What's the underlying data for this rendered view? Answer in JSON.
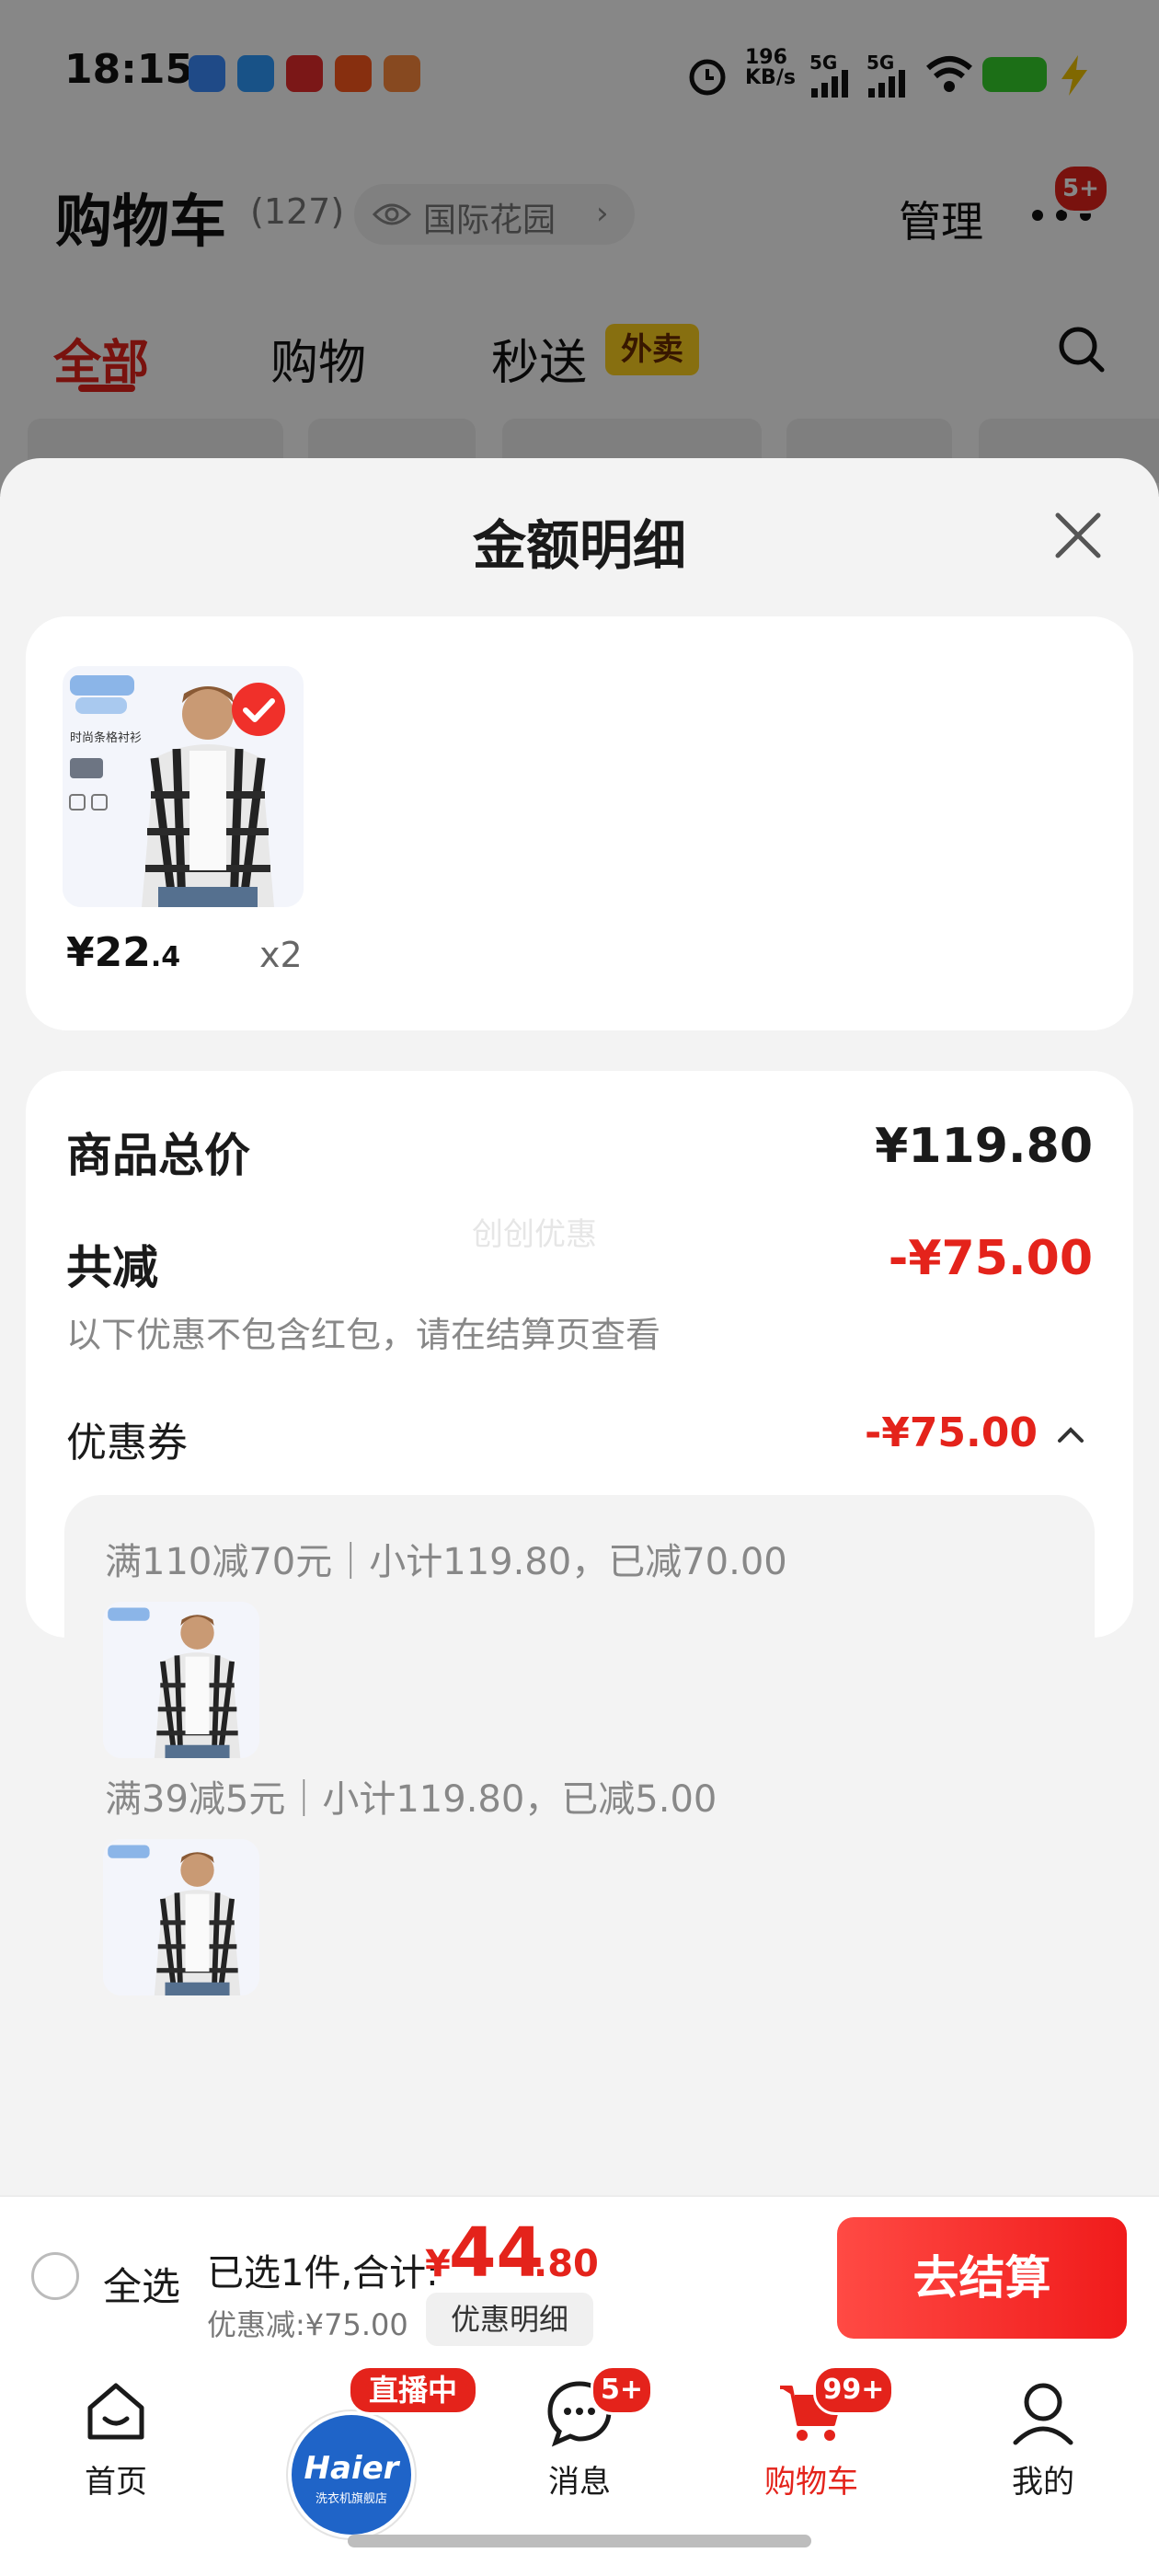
{
  "status_bar": {
    "time": "18:15",
    "net_speed": "196",
    "net_unit": "KB/s",
    "signal1": "5G",
    "signal2": "5G"
  },
  "cart_header": {
    "title": "购物车",
    "count": "(127)",
    "location": "国际花园",
    "manage": "管理",
    "more_badge": "5+"
  },
  "cart_tabs": [
    {
      "label": "全部",
      "active": true
    },
    {
      "label": "购物",
      "active": false
    },
    {
      "label": "秒送",
      "active": false
    }
  ],
  "waimai_tag": "外卖",
  "sheet": {
    "title": "金额明细",
    "product": {
      "price_int": "¥22",
      "price_dec": ".4",
      "qty": "x2",
      "img_text": "时尚条格衬衫"
    },
    "total_label": "商品总价",
    "total_value": "¥119.80",
    "reduce_label": "共减",
    "reduce_value": "-¥75.00",
    "reduce_note": "以下优惠不包含红包，请在结算页查看",
    "watermark": "创创优惠",
    "coupon_label": "优惠券",
    "coupon_value": "-¥75.00",
    "coupon_rules": [
      {
        "text": "满110减70元｜小计119.80，已减70.00"
      },
      {
        "text": "满39减5元｜小计119.80，已减5.00"
      }
    ]
  },
  "bottom_bar": {
    "select_all": "全选",
    "summary": "已选1件,合计:",
    "yen": "¥",
    "total_int": "44",
    "total_dec": ".80",
    "discount": "优惠减:¥75.00",
    "detail_button": "优惠明细",
    "checkout": "去结算"
  },
  "tab_bar": {
    "home": "首页",
    "live_badge": "直播中",
    "brand": "Haier",
    "brand_sub": "洗衣机旗舰店",
    "messages": "消息",
    "messages_badge": "5+",
    "cart": "购物车",
    "cart_badge": "99+",
    "me": "我的"
  },
  "colors": {
    "accent": "#e4231b",
    "checkout_gradient_start": "#ff4a44"
  }
}
